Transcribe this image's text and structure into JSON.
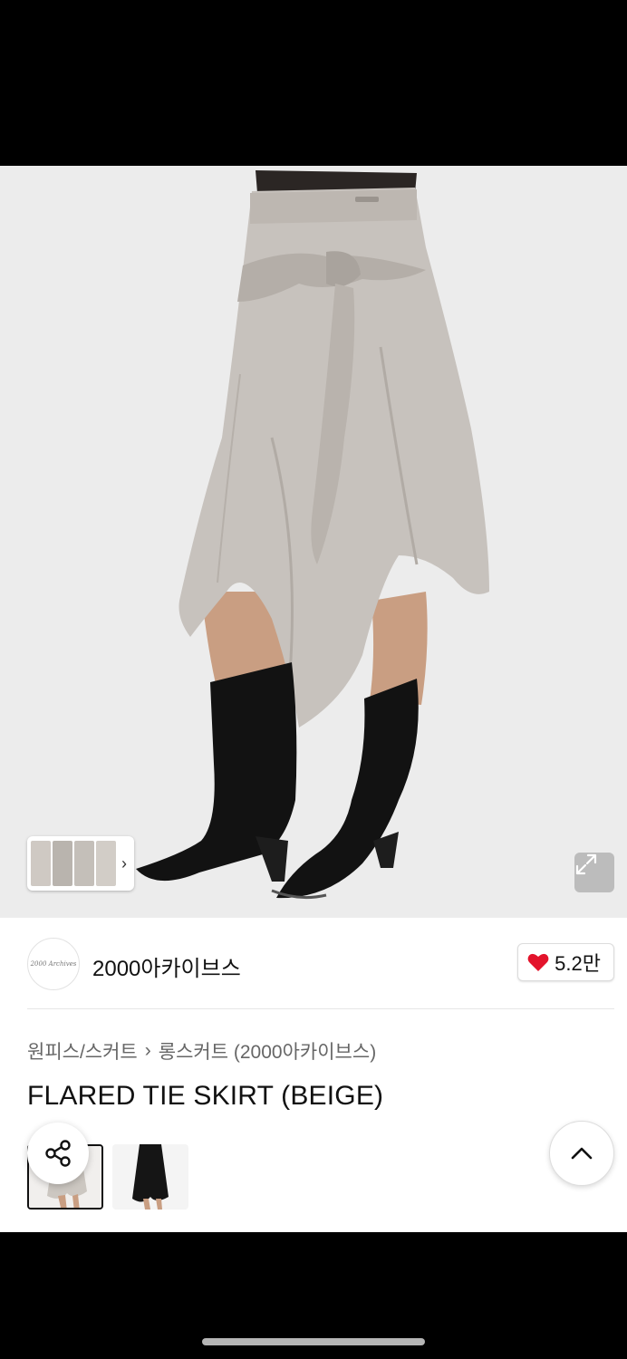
{
  "shop": {
    "name": "2000아카이브스",
    "logo_text": "2000 Archives"
  },
  "likes": {
    "count": "5.2만"
  },
  "breadcrumb": {
    "category": "원피스/스커트",
    "separator": "›",
    "subcategory": "롱스커트 (2000아카이브스)"
  },
  "product": {
    "title": "FLARED TIE SKIRT (BEIGE)"
  },
  "icons": {
    "expand": "expand-icon",
    "heart": "heart-icon",
    "share": "share-icon",
    "scroll_top": "chevron-up-icon",
    "thumb_next": "chevron-right-icon"
  },
  "thumb_strip": {
    "arrow": "›"
  },
  "colors": {
    "heart": "#e3132b",
    "skirt": "#c7c2bd",
    "boots": "#121212",
    "background": "#ececec"
  }
}
